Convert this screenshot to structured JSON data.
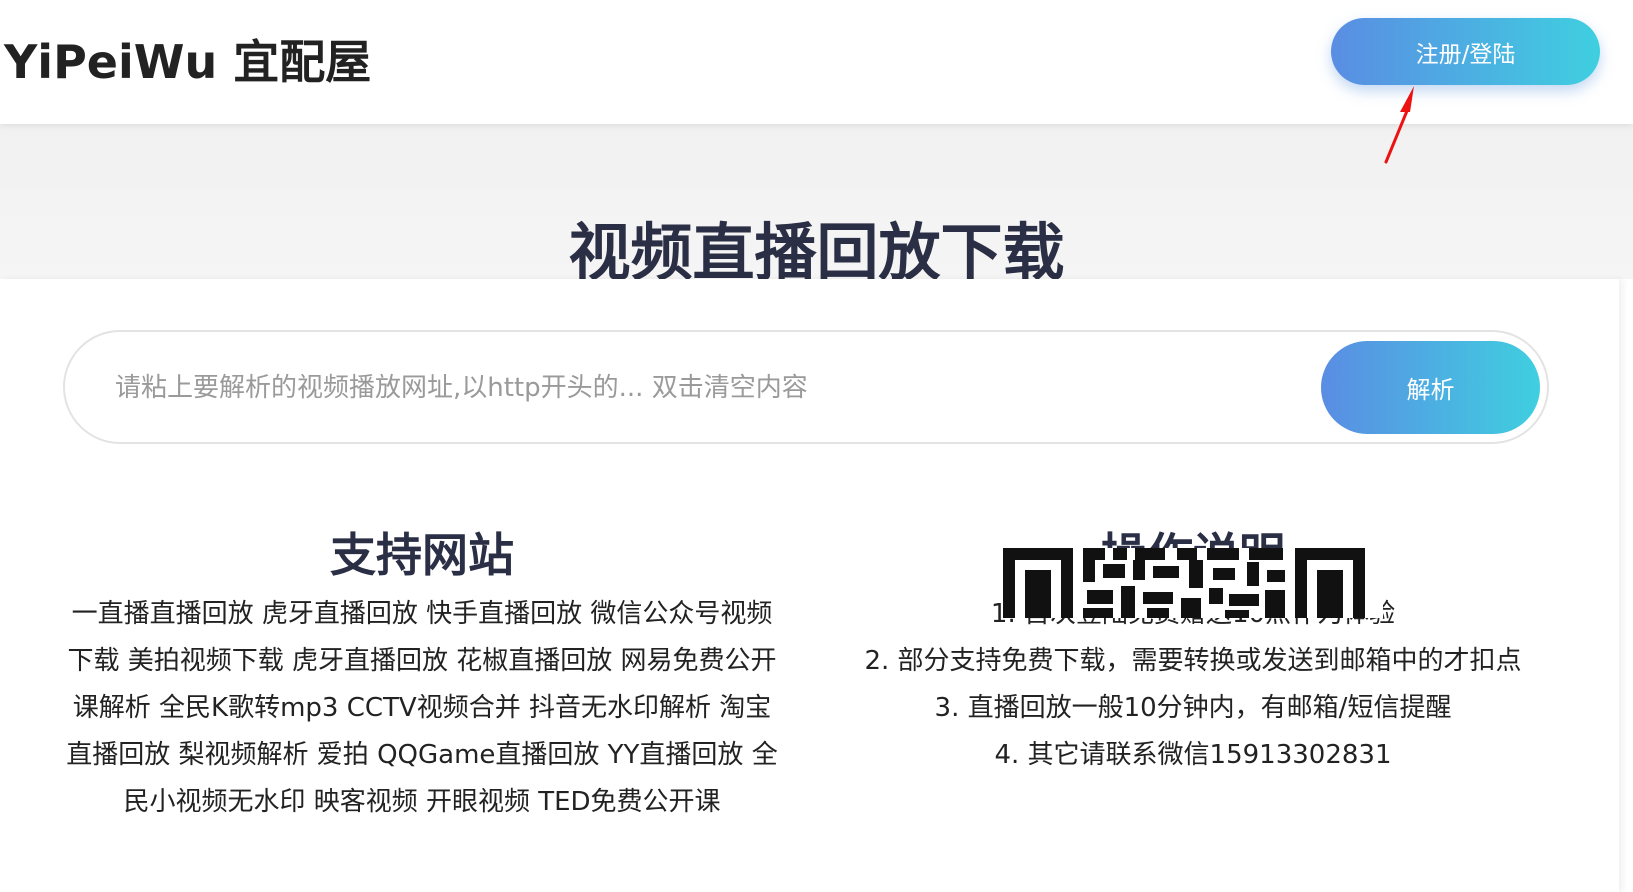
{
  "header": {
    "logo": "YiPeiWu 宜配屋",
    "login_label": "注册/登陆"
  },
  "hero": {
    "title": "视频直播回放下载"
  },
  "search": {
    "placeholder": "请粘上要解析的视频播放网址,以http开头的... 双击清空内容",
    "value": "",
    "button_label": "解析"
  },
  "supported": {
    "title": "支持网站",
    "text": "一直播直播回放 虎牙直播回放 快手直播回放 微信公众号视频下载 美拍视频下载 虎牙直播回放 花椒直播回放 网易免费公开课解析 全民K歌转mp3 CCTV视频合并 抖音无水印解析 淘宝直播回放 梨视频解析 爱拍 QQGame直播回放 YY直播回放 全民小视频无水印 映客视频 开眼视频 TED免费公开课"
  },
  "instructions": {
    "title": "操作说明",
    "steps": [
      "1. 首次登陆免费赠送10点作为体验",
      "2. 部分支持免费下载，需要转换或发送到邮箱中的才扣点",
      "3. 直播回放一般10分钟内，有邮箱/短信提醒",
      "4. 其它请联系微信15913302831"
    ]
  },
  "colors": {
    "gradient_start": "#5a8de3",
    "gradient_end": "#3fcfe0",
    "title_color": "#2b2f45",
    "annotation_arrow": "#ee1111"
  },
  "icons": {
    "annotation": "red-arrow-icon",
    "qr": "qr-code-icon"
  }
}
